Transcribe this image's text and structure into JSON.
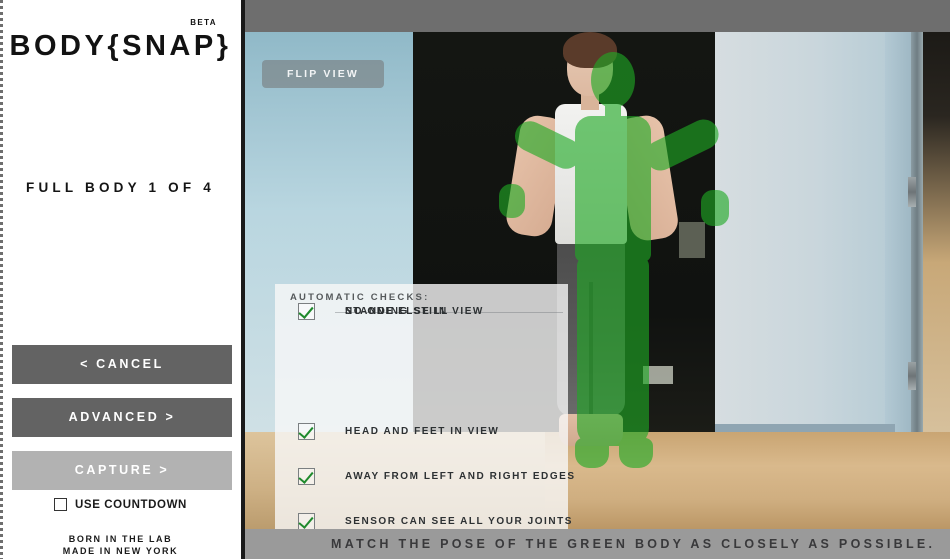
{
  "sidebar": {
    "logo": {
      "text": "BODY{SNAP}",
      "badge": "BETA"
    },
    "step_title": "FULL BODY 1 OF 4",
    "buttons": {
      "cancel": "< CANCEL",
      "advanced": "ADVANCED >",
      "capture": "CAPTURE >"
    },
    "countdown": {
      "label": "USE COUNTDOWN",
      "checked": false
    },
    "footer": "BORN IN THE LAB\nMADE IN NEW YORK",
    "footer_line1": "BORN IN THE LAB",
    "footer_line2": "MADE IN NEW YORK"
  },
  "stage": {
    "flip_view_label": "FLIP VIEW",
    "caption": "MATCH THE POSE OF THE GREEN BODY AS CLOSELY AS POSSIBLE.",
    "checks_panel": {
      "title": "AUTOMATIC CHECKS:",
      "items": [
        {
          "label": "HEAD AND FEET IN VIEW",
          "checked": true
        },
        {
          "label": "AWAY FROM LEFT AND RIGHT EDGES",
          "checked": true
        },
        {
          "label": "SENSOR CAN SEE ALL YOUR JOINTS",
          "checked": true
        },
        {
          "label": "STANDING STILL",
          "checked": true
        },
        {
          "label": "NO ONE ELSE IN VIEW",
          "checked": true
        }
      ]
    }
  },
  "colors": {
    "button_active": "#636363",
    "button_disabled": "#b2b2b2",
    "check_green": "#1f8a2d",
    "chrome_gray": "#6e6e6e",
    "caption_bar": "#9a9a9a"
  }
}
